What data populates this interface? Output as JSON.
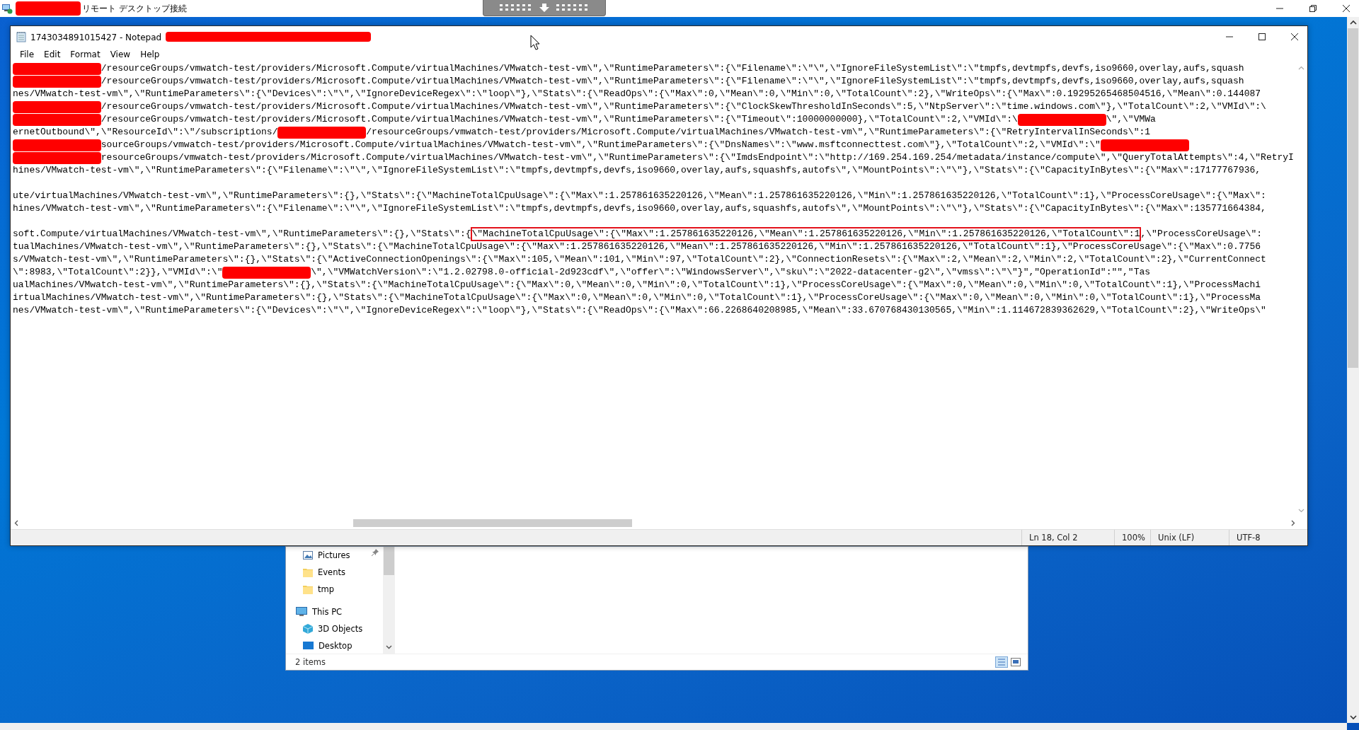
{
  "rdp": {
    "title": "リモート デスクトップ接続"
  },
  "notepad": {
    "title": "1743034891015427 - Notepad",
    "menu": [
      "File",
      "Edit",
      "Format",
      "View",
      "Help"
    ],
    "lines": [
      {
        "kind": "text",
        "segments": [
          {
            "kind": "redacted"
          },
          {
            "kind": "text",
            "text": "/resourceGroups/vmwatch-test/providers/Microsoft.Compute/virtualMachines/VMwatch-test-vm\\\",\\\"RuntimeParameters\\\":{\\\"Filename\\\":\\\"\\\",\\\"IgnoreFileSystemList\\\":\\\"tmpfs,devtmpfs,devfs,iso9660,overlay,aufs,squash"
          }
        ]
      },
      {
        "kind": "text",
        "segments": [
          {
            "kind": "redacted"
          },
          {
            "kind": "text",
            "text": "/resourceGroups/vmwatch-test/providers/Microsoft.Compute/virtualMachines/VMwatch-test-vm\\\",\\\"RuntimeParameters\\\":{\\\"Filename\\\":\\\"\\\",\\\"IgnoreFileSystemList\\\":\\\"tmpfs,devtmpfs,devfs,iso9660,overlay,aufs,squash"
          }
        ]
      },
      {
        "kind": "text",
        "segments": [
          {
            "kind": "text",
            "text": "nes/VMwatch-test-vm\\\",\\\"RuntimeParameters\\\":{\\\"Devices\\\":\\\"\\\",\\\"IgnoreDeviceRegex\\\":\\\"loop\\\"},\\\"Stats\\\":{\\\"ReadOps\\\":{\\\"Max\\\":0,\\\"Mean\\\":0,\\\"Min\\\":0,\\\"TotalCount\\\":2},\\\"WriteOps\\\":{\\\"Max\\\":0.19295265468504516,\\\"Mean\\\":0.144087"
          }
        ]
      },
      {
        "kind": "text",
        "segments": [
          {
            "kind": "redacted"
          },
          {
            "kind": "text",
            "text": "/resourceGroups/vmwatch-test/providers/Microsoft.Compute/virtualMachines/VMwatch-test-vm\\\",\\\"RuntimeParameters\\\":{\\\"ClockSkewThresholdInSeconds\\\":5,\\\"NtpServer\\\":\\\"time.windows.com\\\"},\\\"TotalCount\\\":2,\\\"VMId\\\":\\"
          }
        ]
      },
      {
        "kind": "text",
        "segments": [
          {
            "kind": "redacted"
          },
          {
            "kind": "text",
            "text": "/resourceGroups/vmwatch-test/providers/Microsoft.Compute/virtualMachines/VMwatch-test-vm\\\",\\\"RuntimeParameters\\\":{\\\"Timeout\\\":10000000000},\\\"TotalCount\\\":2,\\\"VMId\\\":\\"
          },
          {
            "kind": "redacted"
          },
          {
            "kind": "text",
            "text": "\\\",\\\"VMWa"
          }
        ]
      },
      {
        "kind": "text",
        "segments": [
          {
            "kind": "text",
            "text": "ernetOutbound\\\",\\\"ResourceId\\\":\\\"/subscriptions/"
          },
          {
            "kind": "redacted"
          },
          {
            "kind": "text",
            "text": "/resourceGroups/vmwatch-test/providers/Microsoft.Compute/virtualMachines/VMwatch-test-vm\\\",\\\"RuntimeParameters\\\":{\\\"RetryIntervalInSeconds\\\":1"
          }
        ]
      },
      {
        "kind": "text",
        "segments": [
          {
            "kind": "redacted"
          },
          {
            "kind": "text",
            "text": "sourceGroups/vmwatch-test/providers/Microsoft.Compute/virtualMachines/VMwatch-test-vm\\\",\\\"RuntimeParameters\\\":{\\\"DnsNames\\\":\\\"www.msftconnecttest.com\\\"},\\\"TotalCount\\\":2,\\\"VMId\\\":\\\""
          },
          {
            "kind": "redacted"
          }
        ]
      },
      {
        "kind": "text",
        "segments": [
          {
            "kind": "redacted"
          },
          {
            "kind": "text",
            "text": "resourceGroups/vmwatch-test/providers/Microsoft.Compute/virtualMachines/VMwatch-test-vm\\\",\\\"RuntimeParameters\\\":{\\\"ImdsEndpoint\\\":\\\"http://169.254.169.254/metadata/instance/compute\\\",\\\"QueryTotalAttempts\\\":4,\\\"RetryI"
          }
        ]
      },
      {
        "kind": "text",
        "segments": [
          {
            "kind": "text",
            "text": "hines/VMwatch-test-vm\\\",\\\"RuntimeParameters\\\":{\\\"Filename\\\":\\\"\\\",\\\"IgnoreFileSystemList\\\":\\\"tmpfs,devtmpfs,devfs,iso9660,overlay,aufs,squashfs,autofs\\\",\\\"MountPoints\\\":\\\"\\\"},\\\"Stats\\\":{\\\"CapacityInBytes\\\":{\\\"Max\\\":17177767936,"
          }
        ]
      },
      {
        "kind": "blank"
      },
      {
        "kind": "text",
        "segments": [
          {
            "kind": "text",
            "text": "ute/virtualMachines/VMwatch-test-vm\\\",\\\"RuntimeParameters\\\":{},\\\"Stats\\\":{\\\"MachineTotalCpuUsage\\\":{\\\"Max\\\":1.257861635220126,\\\"Mean\\\":1.257861635220126,\\\"Min\\\":1.257861635220126,\\\"TotalCount\\\":1},\\\"ProcessCoreUsage\\\":{\\\"Max\\\":"
          }
        ]
      },
      {
        "kind": "text",
        "segments": [
          {
            "kind": "text",
            "text": "hines/VMwatch-test-vm\\\",\\\"RuntimeParameters\\\":{\\\"Filename\\\":\\\"\\\",\\\"IgnoreFileSystemList\\\":\\\"tmpfs,devtmpfs,devfs,iso9660,overlay,aufs,squashfs,autofs\\\",\\\"MountPoints\\\":\\\"\\\"},\\\"Stats\\\":{\\\"CapacityInBytes\\\":{\\\"Max\\\":135771664384,"
          }
        ]
      },
      {
        "kind": "blank"
      },
      {
        "kind": "text",
        "segments": [
          {
            "kind": "text",
            "text": "soft.Compute/virtualMachines/VMwatch-test-vm\\\",\\\"RuntimeParameters\\\":{},\\\"Stats\\\":{"
          },
          {
            "kind": "highlight",
            "text": "\\\"MachineTotalCpuUsage\\\":{\\\"Max\\\":1.257861635220126,\\\"Mean\\\":1.257861635220126,\\\"Min\\\":1.257861635220126,\\\"TotalCount\\\":1"
          },
          {
            "kind": "text",
            "text": ",\\\"ProcessCoreUsage\\\":"
          }
        ]
      },
      {
        "kind": "text",
        "segments": [
          {
            "kind": "text",
            "text": "tualMachines/VMwatch-test-vm\\\",\\\"RuntimeParameters\\\":{},\\\"Stats\\\":{\\\"MachineTotalCpuUsage\\\":{\\\"Max\\\":1.257861635220126,\\\"Mean\\\":1.257861635220126,\\\"Min\\\":1.257861635220126,\\\"TotalCount\\\":1},\\\"ProcessCoreUsage\\\":{\\\"Max\\\":0.7756"
          }
        ]
      },
      {
        "kind": "text",
        "segments": [
          {
            "kind": "text",
            "text": "s/VMwatch-test-vm\\\",\\\"RuntimeParameters\\\":{},\\\"Stats\\\":{\\\"ActiveConnectionOpenings\\\":{\\\"Max\\\":105,\\\"Mean\\\":101,\\\"Min\\\":97,\\\"TotalCount\\\":2},\\\"ConnectionResets\\\":{\\\"Max\\\":2,\\\"Mean\\\":2,\\\"Min\\\":2,\\\"TotalCount\\\":2},\\\"CurrentConnect"
          }
        ]
      },
      {
        "kind": "text",
        "segments": [
          {
            "kind": "text",
            "text": "\\\":8983,\\\"TotalCount\\\":2}},\\\"VMId\\\":\\\""
          },
          {
            "kind": "redacted"
          },
          {
            "kind": "text",
            "text": "\\\",\\\"VMWatchVersion\\\":\\\"1.2.02798.0-official-2d923cdf\\\",\\\"offer\\\":\\\"WindowsServer\\\",\\\"sku\\\":\\\"2022-datacenter-g2\\\",\\\"vmss\\\":\\\"\\\"}\",\"OperationId\":\"\",\"Tas"
          }
        ]
      },
      {
        "kind": "text",
        "segments": [
          {
            "kind": "text",
            "text": "ualMachines/VMwatch-test-vm\\\",\\\"RuntimeParameters\\\":{},\\\"Stats\\\":{\\\"MachineTotalCpuUsage\\\":{\\\"Max\\\":0,\\\"Mean\\\":0,\\\"Min\\\":0,\\\"TotalCount\\\":1},\\\"ProcessCoreUsage\\\":{\\\"Max\\\":0,\\\"Mean\\\":0,\\\"Min\\\":0,\\\"TotalCount\\\":1},\\\"ProcessMachi"
          }
        ]
      },
      {
        "kind": "text",
        "segments": [
          {
            "kind": "text",
            "text": "irtualMachines/VMwatch-test-vm\\\",\\\"RuntimeParameters\\\":{},\\\"Stats\\\":{\\\"MachineTotalCpuUsage\\\":{\\\"Max\\\":0,\\\"Mean\\\":0,\\\"Min\\\":0,\\\"TotalCount\\\":1},\\\"ProcessCoreUsage\\\":{\\\"Max\\\":0,\\\"Mean\\\":0,\\\"Min\\\":0,\\\"TotalCount\\\":1},\\\"ProcessMa"
          }
        ]
      },
      {
        "kind": "text",
        "segments": [
          {
            "kind": "text",
            "text": "nes/VMwatch-test-vm\\\",\\\"RuntimeParameters\\\":{\\\"Devices\\\":\\\"\\\",\\\"IgnoreDeviceRegex\\\":\\\"loop\\\"},\\\"Stats\\\":{\\\"ReadOps\\\":{\\\"Max\\\":66.2268640208985,\\\"Mean\\\":33.670768430130565,\\\"Min\\\":1.114672839362629,\\\"TotalCount\\\":2},\\\"WriteOps\\\""
          }
        ]
      }
    ],
    "status": [
      "Ln 18, Col 2",
      "100%",
      "Unix (LF)",
      "UTF-8"
    ]
  },
  "explorer": {
    "nav": [
      {
        "label": "Pictures",
        "kind": "pictures",
        "pinned": true
      },
      {
        "label": "Events",
        "kind": "folder",
        "pinned": false
      },
      {
        "label": "tmp",
        "kind": "folder",
        "pinned": false
      },
      {
        "label": "This PC",
        "kind": "pc",
        "pinned": false
      },
      {
        "label": "3D Objects",
        "kind": "objects3d",
        "pinned": false
      },
      {
        "label": "Desktop",
        "kind": "desktop",
        "pinned": false
      }
    ],
    "status": "2 items"
  }
}
